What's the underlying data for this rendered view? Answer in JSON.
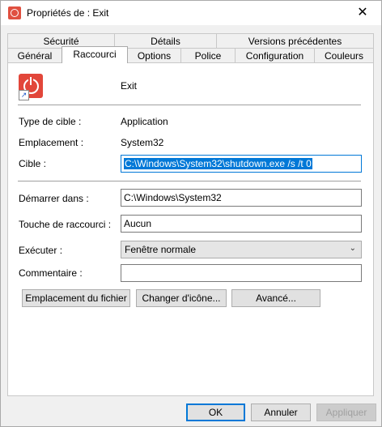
{
  "window": {
    "title": "Propriétés de : Exit",
    "close_glyph": "✕"
  },
  "tabs_row1": [
    "Sécurité",
    "Détails",
    "Versions précédentes"
  ],
  "tabs_row2": [
    "Général",
    "Raccourci",
    "Options",
    "Police",
    "Configuration",
    "Couleurs"
  ],
  "active_tab": "Raccourci",
  "shortcut": {
    "name": "Exit",
    "target_type_label": "Type de cible :",
    "target_type_value": "Application",
    "location_label": "Emplacement :",
    "location_value": "System32",
    "target_label": "Cible :",
    "target_value": "C:\\Windows\\System32\\shutdown.exe /s /t 0",
    "start_in_label": "Démarrer dans :",
    "start_in_value": "C:\\Windows\\System32",
    "hotkey_label": "Touche de raccourci :",
    "hotkey_value": "Aucun",
    "run_label": "Exécuter :",
    "run_value": "Fenêtre normale",
    "comment_label": "Commentaire :",
    "comment_value": ""
  },
  "buttons": {
    "open_location": "Emplacement du fichier",
    "change_icon": "Changer d'icône...",
    "advanced": "Avancé...",
    "ok": "OK",
    "cancel": "Annuler",
    "apply": "Appliquer"
  },
  "colors": {
    "accent": "#0078d7",
    "icon": "#e2463a"
  },
  "icons": {
    "app_icon": "power-icon",
    "shortcut_overlay": "shortcut-arrow-icon"
  }
}
